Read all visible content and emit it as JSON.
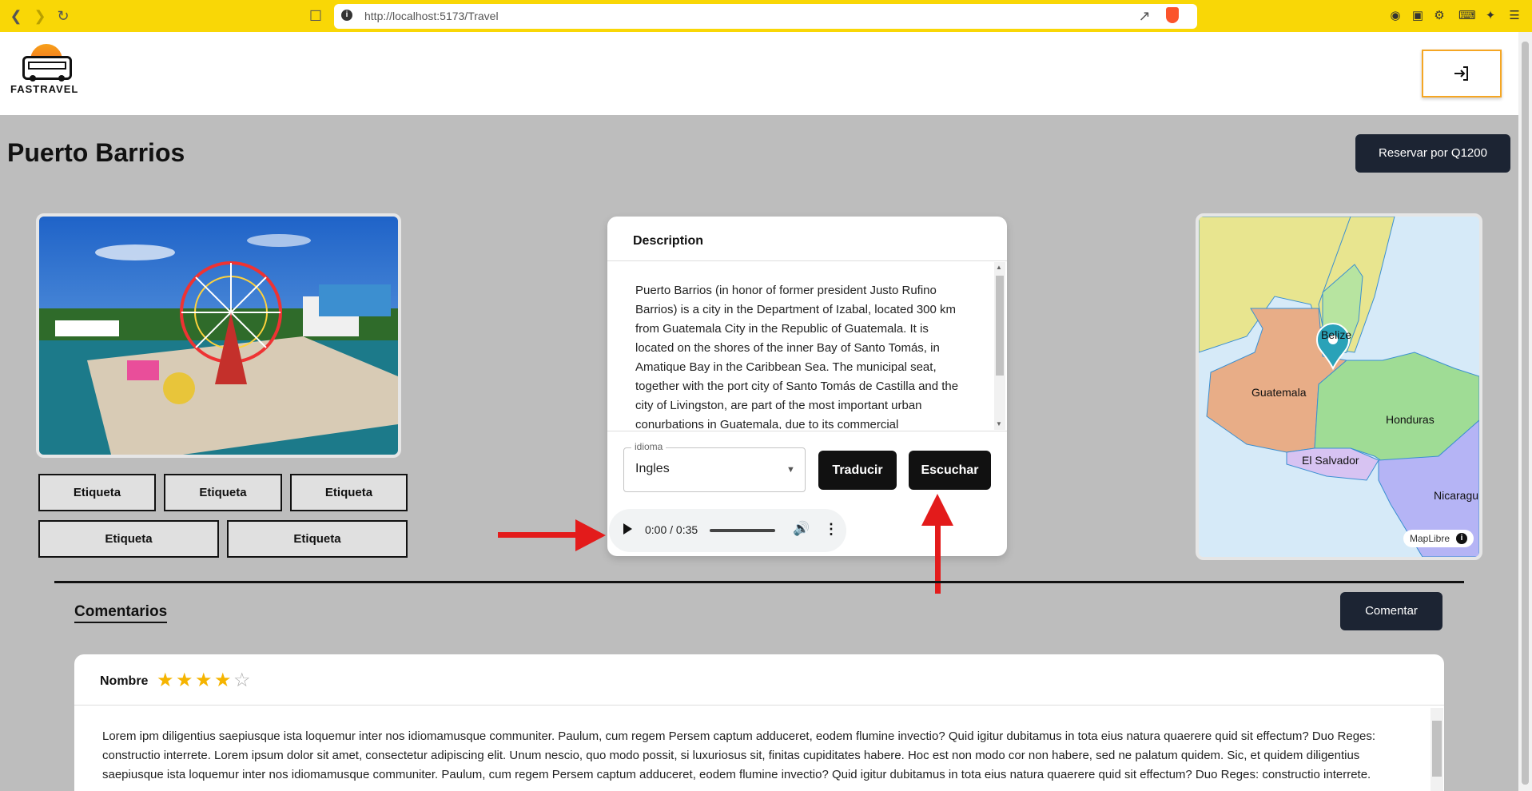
{
  "browser": {
    "url": "http://localhost:5173/Travel"
  },
  "header": {
    "logo_text": "FASTRAVEL"
  },
  "page": {
    "title": "Puerto Barrios",
    "reserve_button": "Reservar por Q1200"
  },
  "tags": [
    "Etiqueta",
    "Etiqueta",
    "Etiqueta",
    "Etiqueta",
    "Etiqueta"
  ],
  "description": {
    "heading": "Description",
    "text": "Puerto Barrios (in honor of former president Justo Rufino Barrios) is a city in the Department of Izabal, located 300 km from Guatemala City in the Republic of Guatemala. It is located on the shores of the inner Bay of Santo Tomás, in Amatique Bay in the Caribbean Sea. The municipal seat, together with the port city of Santo Tomás de Castilla and the city of Livingston, are part of the most important urban conurbations in Guatemala, due to its commercial",
    "language_label": "idioma",
    "language_value": "Ingles",
    "translate_button": "Traducir",
    "listen_button": "Escuchar",
    "audio_time": "0:00 / 0:35"
  },
  "map": {
    "labels": [
      "Belize",
      "Guatemala",
      "Honduras",
      "El Salvador",
      "Nicaragu"
    ],
    "attribution": "MapLibre"
  },
  "comments": {
    "title": "Comentarios",
    "comment_button": "Comentar",
    "items": [
      {
        "name": "Nombre",
        "rating": 4,
        "max_rating": 5,
        "text": "Lorem ipm diligentius saepiusque ista loquemur inter nos idiomamusque communiter. Paulum, cum regem Persem captum adduceret, eodem flumine invectio? Quid igitur dubitamus in tota eius natura quaerere quid sit effectum? Duo Reges: constructio interrete. Lorem ipsum dolor sit amet, consectetur adipiscing elit. Unum nescio, quo modo possit, si luxuriosus sit, finitas cupiditates habere. Hoc est non modo cor non habere, sed ne palatum quidem. Sic, et quidem diligentius saepiusque ista loquemur inter nos idiomamusque communiter. Paulum, cum regem Persem captum adduceret, eodem flumine invectio? Quid igitur dubitamus in tota eius natura quaerere quid sit effectum? Duo Reges: constructio interrete."
      }
    ]
  },
  "colors": {
    "chrome": "#f9d706",
    "dark_button": "#1c2433",
    "black_button": "#111111",
    "star": "#f5b400",
    "arrow": "#e31b1b",
    "logout_border": "#f5a623"
  }
}
